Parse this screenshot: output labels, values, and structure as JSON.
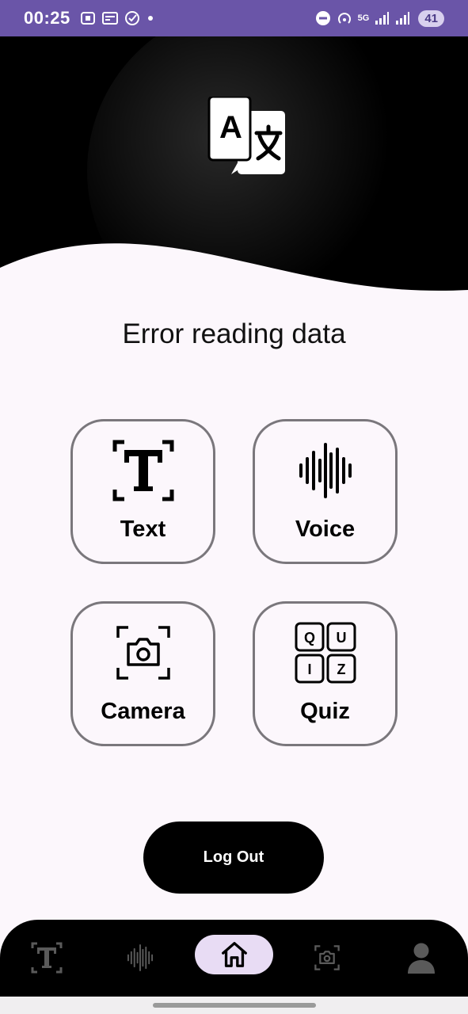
{
  "status_bar": {
    "time": "00:25",
    "battery": "41",
    "network": "5G"
  },
  "header": {
    "logo_icon": "translate-icon",
    "logo_letter": "A"
  },
  "main": {
    "title": "Error reading data"
  },
  "cards": [
    {
      "label": "Text",
      "icon": "text-scan-icon"
    },
    {
      "label": "Voice",
      "icon": "voice-wave-icon"
    },
    {
      "label": "Camera",
      "icon": "camera-scan-icon"
    },
    {
      "label": "Quiz",
      "icon": "quiz-grid-icon",
      "letters": [
        "Q",
        "U",
        "I",
        "Z"
      ]
    }
  ],
  "logout_label": "Log Out",
  "bottom_nav": {
    "items": [
      {
        "icon": "text-scan-icon",
        "active": false
      },
      {
        "icon": "voice-wave-icon",
        "active": false
      },
      {
        "icon": "home-icon",
        "active": true
      },
      {
        "icon": "camera-scan-icon",
        "active": false
      },
      {
        "icon": "profile-icon",
        "active": false
      }
    ]
  },
  "colors": {
    "status_bar": "#6a55a8",
    "header": "#000000",
    "page_background": "#fcf7fc",
    "card_border": "#7a777c",
    "nav_active": "#e8dcf4"
  }
}
